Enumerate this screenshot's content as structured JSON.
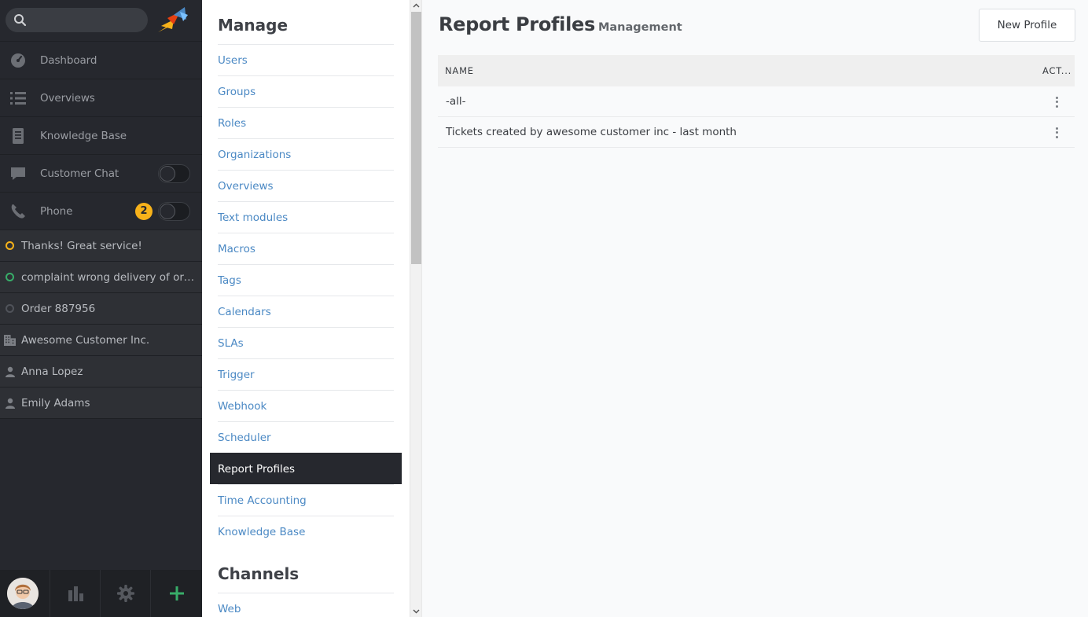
{
  "nav": {
    "search": {
      "value": "",
      "placeholder": ""
    },
    "items": [
      {
        "label": "Dashboard",
        "icon": "dashboard-icon"
      },
      {
        "label": "Overviews",
        "icon": "list-icon"
      },
      {
        "label": "Knowledge Base",
        "icon": "book-icon"
      },
      {
        "label": "Customer Chat",
        "icon": "chat-icon",
        "toggle": false
      },
      {
        "label": "Phone",
        "icon": "phone-icon",
        "badge": "2",
        "toggle": false
      }
    ],
    "tasks": [
      {
        "label": "Thanks! Great service!",
        "icon": "ticket-status-icon",
        "color": "#f7b21a"
      },
      {
        "label": "complaint wrong delivery of order",
        "icon": "ticket-status-icon",
        "color": "#38ad69"
      },
      {
        "label": "Order 887956",
        "icon": "ticket-status-icon",
        "color": "#50535a"
      },
      {
        "label": "Awesome Customer Inc.",
        "icon": "organization-icon"
      },
      {
        "label": "Anna Lopez",
        "icon": "user-icon"
      },
      {
        "label": "Emily Adams",
        "icon": "user-icon"
      }
    ],
    "bottom": [
      "avatar",
      "reporting-icon",
      "settings-icon",
      "plus-icon"
    ]
  },
  "menu": {
    "manage_heading": "Manage",
    "manage_items": [
      "Users",
      "Groups",
      "Roles",
      "Organizations",
      "Overviews",
      "Text modules",
      "Macros",
      "Tags",
      "Calendars",
      "SLAs",
      "Trigger",
      "Webhook",
      "Scheduler",
      "Report Profiles",
      "Time Accounting",
      "Knowledge Base"
    ],
    "active_item": "Report Profiles",
    "channels_heading": "Channels",
    "channels_items": [
      "Web"
    ]
  },
  "page": {
    "title": "Report Profiles",
    "subtitle": "Management",
    "new_button": "New Profile",
    "columns": {
      "name": "NAME",
      "actions": "ACT..."
    },
    "rows": [
      {
        "name": "-all-"
      },
      {
        "name": "Tickets created by awesome customer inc - last month"
      }
    ]
  },
  "colors": {
    "nav_bg": "#26282e",
    "link": "#4b89c4",
    "badge": "#f7b21a",
    "add_button": "#38ad69"
  }
}
